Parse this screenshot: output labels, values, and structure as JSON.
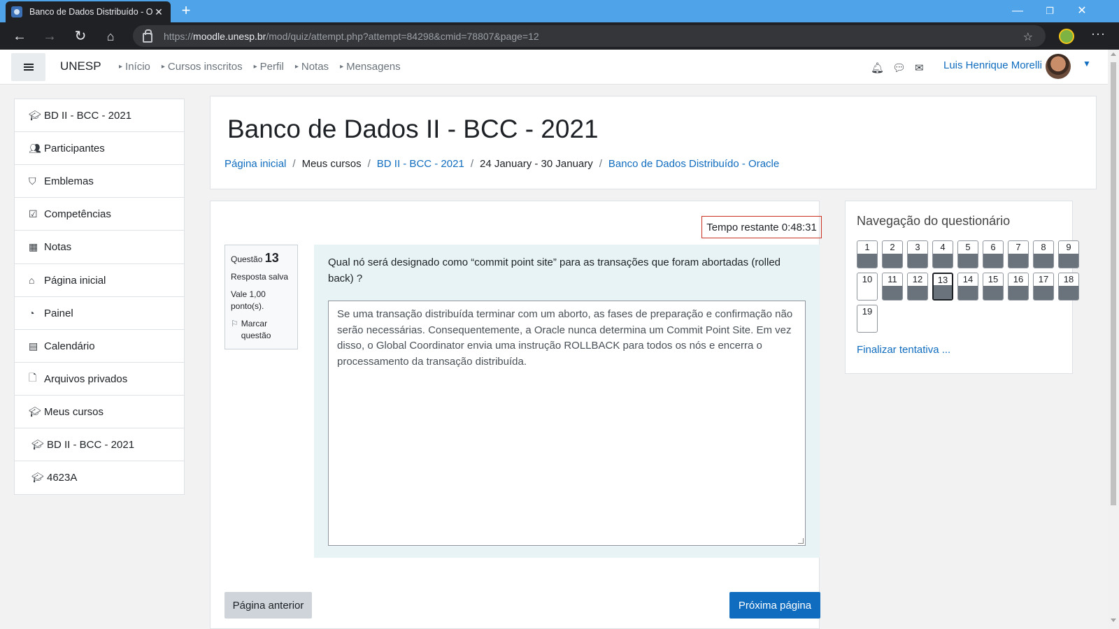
{
  "browser": {
    "tab_title": "Banco de Dados Distribuído - Or",
    "tab_close": "✕",
    "new_tab": "+",
    "url_prefix": "https://",
    "url_host": "moodle.unesp.br",
    "url_path": "/mod/quiz/attempt.php?attempt=84298&cmid=78807&page=12",
    "window_controls": {
      "minimize": "—",
      "maximize": "❐",
      "close": "✕"
    }
  },
  "navbar": {
    "brand": "UNESP",
    "links": [
      "Início",
      "Cursos inscritos",
      "Perfil",
      "Notas",
      "Mensagens"
    ],
    "user_name": "Luis Henrique Morelli"
  },
  "drawer": {
    "course_group": [
      {
        "icon": "graduation-cap-icon",
        "label": "BD II - BCC - 2021"
      },
      {
        "icon": "users-icon",
        "label": "Participantes"
      },
      {
        "icon": "shield-icon",
        "label": "Emblemas"
      },
      {
        "icon": "checkbox-icon",
        "label": "Competências"
      },
      {
        "icon": "table-icon",
        "label": "Notas"
      }
    ],
    "site_group": [
      {
        "icon": "home-icon",
        "label": "Página inicial"
      },
      {
        "icon": "dashboard-icon",
        "label": "Painel"
      },
      {
        "icon": "calendar-icon",
        "label": "Calendário"
      },
      {
        "icon": "file-icon",
        "label": "Arquivos privados"
      },
      {
        "icon": "graduation-cap-icon",
        "label": "Meus cursos"
      },
      {
        "icon": "graduation-cap-icon",
        "label": "BD II - BCC - 2021"
      },
      {
        "icon": "graduation-cap-icon",
        "label": "4623A"
      }
    ]
  },
  "header": {
    "title": "Banco de Dados II - BCC - 2021",
    "breadcrumb": [
      {
        "label": "Página inicial",
        "link": true
      },
      {
        "label": "Meus cursos",
        "link": false
      },
      {
        "label": "BD II - BCC - 2021",
        "link": true
      },
      {
        "label": "24 January - 30 January",
        "link": false
      },
      {
        "label": "Banco de Dados Distribuído - Oracle",
        "link": true
      }
    ]
  },
  "quiz": {
    "timer": "Tempo restante 0:48:31",
    "info": {
      "question_label": "Questão",
      "question_number": "13",
      "status": "Resposta salva",
      "points": "Vale 1,00 ponto(s).",
      "flag": "Marcar questão"
    },
    "question_text": "Qual nó será designado como “commit point site” para as transações que foram abortadas (rolled back) ?",
    "answer": "Se uma transação distribuída terminar com um aborto, as fases de preparação e confirmação não serão necessárias. Consequentemente, a Oracle nunca determina um Commit Point Site. Em vez disso, o Global Coordinator envia uma instrução ROLLBACK para todos os nós e encerra o processamento da transação distribuída.",
    "prev_button": "Página anterior",
    "next_button": "Próxima página"
  },
  "quiz_nav": {
    "title": "Navegação do questionário",
    "questions": [
      {
        "n": "1",
        "answered": true
      },
      {
        "n": "2",
        "answered": true
      },
      {
        "n": "3",
        "answered": true
      },
      {
        "n": "4",
        "answered": true
      },
      {
        "n": "5",
        "answered": true
      },
      {
        "n": "6",
        "answered": true
      },
      {
        "n": "7",
        "answered": true
      },
      {
        "n": "8",
        "answered": true
      },
      {
        "n": "9",
        "answered": true
      },
      {
        "n": "10",
        "answered": false
      },
      {
        "n": "11",
        "answered": true
      },
      {
        "n": "12",
        "answered": true
      },
      {
        "n": "13",
        "answered": true,
        "current": true
      },
      {
        "n": "14",
        "answered": true
      },
      {
        "n": "15",
        "answered": true
      },
      {
        "n": "16",
        "answered": true
      },
      {
        "n": "17",
        "answered": true
      },
      {
        "n": "18",
        "answered": true
      },
      {
        "n": "19",
        "answered": false
      }
    ],
    "finish_link": "Finalizar tentativa ..."
  },
  "colors": {
    "primary": "#0f6cbf",
    "timer_border": "#ca3120",
    "question_bg": "#e7f3f5",
    "answered_fill": "#6a737b"
  }
}
